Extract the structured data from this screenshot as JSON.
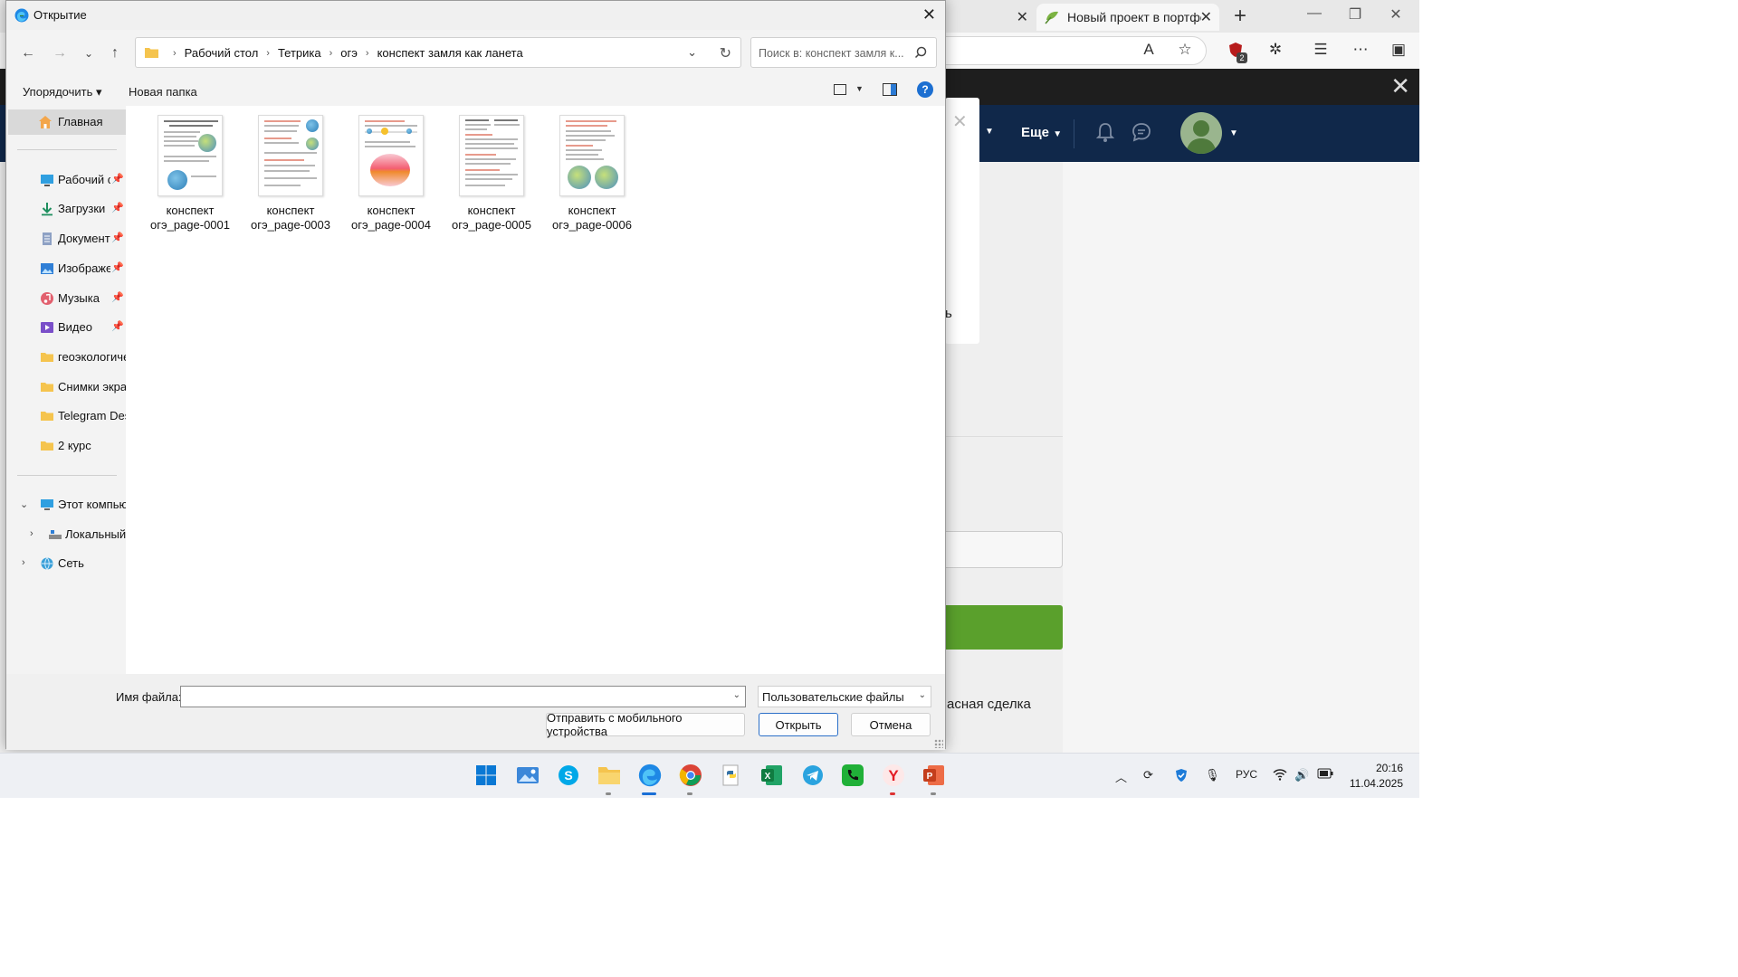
{
  "browser": {
    "prev_tab_close": "✕",
    "active_tab_title": "Новый проект в портфолио",
    "active_tab_close": "✕",
    "new_tab": "+",
    "nav_more": "Еще",
    "modal_text_fragment": "ь",
    "deal_text_fragment": "асная сделка",
    "extension_badge": "2"
  },
  "dialog": {
    "title": "Открытие",
    "breadcrumbs": [
      "Рабочий стол",
      "Тетрика",
      "огэ",
      "конспект замля как ланета"
    ],
    "search_placeholder": "Поиск в: конспект замля к...",
    "organize_label": "Упорядочить ▾",
    "new_folder_label": "Новая папка",
    "help_label": "?",
    "nav": {
      "home": "Главная",
      "quick_access": [
        {
          "label": "Рабочий с",
          "icon": "desktop-icon",
          "pinned": true
        },
        {
          "label": "Загрузки",
          "icon": "download-icon",
          "pinned": true
        },
        {
          "label": "Документы",
          "icon": "document-icon",
          "pinned": true
        },
        {
          "label": "Изображения",
          "icon": "pictures-icon",
          "pinned": true
        },
        {
          "label": "Музыка",
          "icon": "music-icon",
          "pinned": true
        },
        {
          "label": "Видео",
          "icon": "video-icon",
          "pinned": true
        },
        {
          "label": "геоэкологические",
          "icon": "folder-icon",
          "pinned": false
        },
        {
          "label": "Снимки экрана",
          "icon": "folder-icon",
          "pinned": false
        },
        {
          "label": "Telegram Desktop",
          "icon": "folder-icon",
          "pinned": false
        },
        {
          "label": "2 курс",
          "icon": "folder-icon",
          "pinned": false
        }
      ],
      "this_pc": "Этот компьютер",
      "local_disk": "Локальный диск",
      "network": "Сеть"
    },
    "files": [
      {
        "line1": "конспект",
        "line2": "огэ_page-0001"
      },
      {
        "line1": "конспект",
        "line2": "огэ_page-0003"
      },
      {
        "line1": "конспект",
        "line2": "огэ_page-0004"
      },
      {
        "line1": "конспект",
        "line2": "огэ_page-0005"
      },
      {
        "line1": "конспект",
        "line2": "огэ_page-0006"
      }
    ],
    "filename_label": "Имя файла:",
    "filename_value": "",
    "filter_value": "Пользовательские файлы",
    "send_mobile_label": "Отправить с мобильного устройства",
    "open_label": "Открыть",
    "cancel_label": "Отмена"
  },
  "taskbar": {
    "apps": [
      "windows-start-icon",
      "photos-icon",
      "skype-icon",
      "file-explorer-icon",
      "edge-icon",
      "chrome-icon",
      "python-icon",
      "excel-icon",
      "telegram-icon",
      "phone-icon",
      "yandex-icon",
      "powerpoint-icon"
    ],
    "language": "РУС",
    "time": "20:16",
    "date": "11.04.2025"
  },
  "colors": {
    "accent": "#1a6fd6",
    "web_navbar": "#10284a",
    "green_button": "#5aa02c"
  }
}
